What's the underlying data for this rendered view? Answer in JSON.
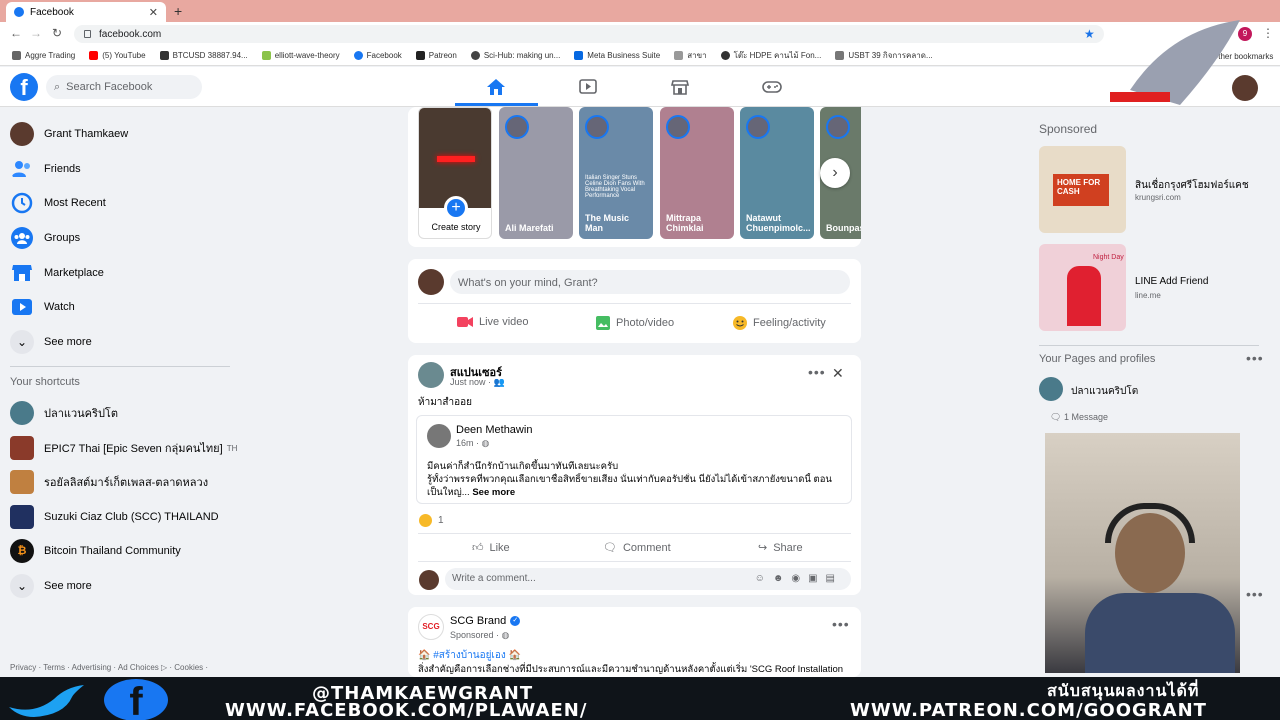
{
  "browser": {
    "tab_title": "Facebook",
    "url": "facebook.com",
    "bookmarks": [
      "Aggre Trading",
      "(5) YouTube",
      "BTCUSD 38887.94...",
      "elliott-wave-theory",
      "Facebook",
      "Patreon",
      "Sci-Hub: making un...",
      "Meta Business Suite",
      "สาขา",
      "โต๊ะ HDPE คานไม้ Fon...",
      "USBT 39 กิจการคลาด..."
    ],
    "other_bookmarks": "Other bookmarks",
    "profile_badge": "9"
  },
  "header": {
    "search_placeholder": "Search Facebook"
  },
  "sidebar": {
    "items": [
      {
        "label": "Grant Thamkaew",
        "icon": "profile-avatar",
        "color": "#5a3a2e"
      },
      {
        "label": "Friends",
        "icon": "friends-icon",
        "color": "#2d88ff"
      },
      {
        "label": "Most Recent",
        "icon": "most-recent-icon",
        "color": "#1877f2"
      },
      {
        "label": "Groups",
        "icon": "groups-icon",
        "color": "#1877f2"
      },
      {
        "label": "Marketplace",
        "icon": "marketplace-icon",
        "color": "#1877f2"
      },
      {
        "label": "Watch",
        "icon": "watch-icon",
        "color": "#1877f2"
      },
      {
        "label": "See more",
        "icon": "chevron-down-icon",
        "color": "#e4e6eb"
      }
    ],
    "shortcuts_title": "Your shortcuts",
    "shortcuts": [
      {
        "label": "ปลาแวนคริปโต",
        "color": "#4a7a8a"
      },
      {
        "label": "EPIC7 Thai [Epic Seven กลุ่มคนไทย]",
        "suffix": "TH",
        "color": "#8a3a2a"
      },
      {
        "label": "รอยัลลิสต์มาร์เก็ตเพลส-ตลาดหลวง",
        "color": "#c08040"
      },
      {
        "label": "Suzuki Ciaz Club (SCC) THAILAND",
        "color": "#203060"
      },
      {
        "label": "Bitcoin Thailand Community",
        "color": "#f7931a"
      },
      {
        "label": "See more",
        "color": "#e4e6eb"
      }
    ],
    "footer": "Privacy · Terms · Advertising · Ad Choices ▷ · Cookies ·"
  },
  "stories": {
    "create_label": "Create story",
    "items": [
      {
        "name": "Ali Marefati",
        "bg": "#9a9aa8"
      },
      {
        "name": "The Music Man",
        "bg": "#6a8aa8",
        "caption": "Italian Singer Stuns Celine Dion Fans With Breathtaking Vocal Performance"
      },
      {
        "name": "Mittrapa Chimklai",
        "bg": "#b08090"
      },
      {
        "name": "Natawut Chuenpimolc...",
        "bg": "#5a8aa0"
      },
      {
        "name": "Bounpas Tee...",
        "bg": "#6a7a6a"
      }
    ]
  },
  "composer": {
    "placeholder": "What's on your mind, Grant?",
    "live_video": "Live video",
    "photo_video": "Photo/video",
    "feeling": "Feeling/activity",
    "colors": {
      "live": "#f3425f",
      "photo": "#45bd62",
      "feeling": "#f7b928"
    }
  },
  "post1": {
    "author": "สแปนเซอร์",
    "time": "Just now",
    "text": "ห้ามาสำออย",
    "shared_author": "Deen Methawin",
    "shared_time": "16m",
    "shared_line1": "มีคนค่าก็สำนึกรักบ้านเกิดขึ้นมาทันทีเลยนะครับ",
    "shared_line2": "รู้ทั้งว่าพรรคที่พวกคุณเลือกเขาชื่อสิทธิ์ขายเสียง นั่นเท่ากับคอรัปชั่น นี่ยังไม่ได้เข้าสภายังขนาดนี้ ตอน",
    "shared_line3": "เป็นใหญ่...",
    "see_more": "See more",
    "reaction_count": "1",
    "like": "Like",
    "comment": "Comment",
    "share": "Share",
    "comment_placeholder": "Write a comment..."
  },
  "post2": {
    "author": "SCG Brand",
    "sponsored": "Sponsored",
    "hashtag": "#สร้างบ้านอยู่เอง",
    "text": "สิ่งสำคัญคือการเลือกช่างที่มีประสบการณ์และมีความชำนาญด้านหลังคาตั้งแต่เริ่ม 'SCG Roof Installation'"
  },
  "right": {
    "sponsored_title": "Sponsored",
    "ads": [
      {
        "title": "สินเชื่อกรุงศรีโฮมฟอร์แคช",
        "domain": "krungsri.com",
        "img_text": "HOME FOR CASH",
        "img_bg": "#e8dcc8"
      },
      {
        "title": "LINE Add Friend",
        "domain": "line.me",
        "img_text": "Night Day",
        "img_bg": "#f0d0d8"
      }
    ],
    "pages_title": "Your Pages and profiles",
    "page_name": "ปลาแวนคริปโต",
    "message_count": "1 Message"
  },
  "banner": {
    "handle": "@THAMKAEWGRANT",
    "facebook_url": "WWW.FACEBOOK.COM/PLAWAEN/",
    "support": "สนับสนุนผลงานได้ที่",
    "patreon_url": "WWW.PATREON.COM/GOOGRANT",
    "twitter_color": "#1da1f2",
    "fb_color": "#1877f2"
  }
}
